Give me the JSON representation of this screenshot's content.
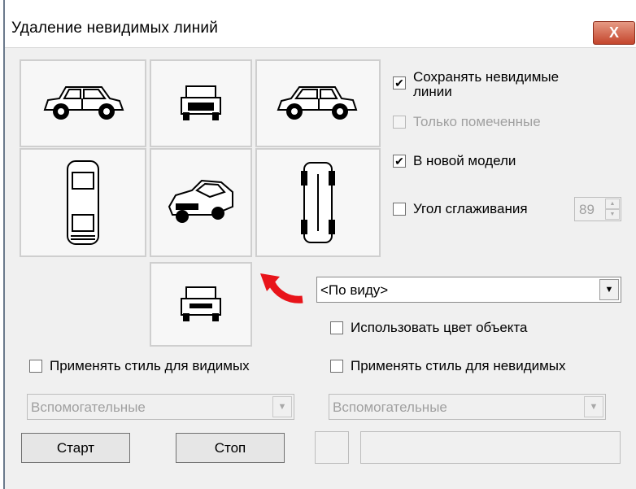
{
  "window": {
    "title": "Удаление невидимых линий",
    "close_label": "X"
  },
  "views": [
    {
      "name": "left"
    },
    {
      "name": "front"
    },
    {
      "name": "right"
    },
    {
      "name": "top"
    },
    {
      "name": "iso"
    },
    {
      "name": "bottom"
    },
    {
      "name": "rear"
    }
  ],
  "options": {
    "save_hidden": {
      "label": "Сохранять невидимые\nлинии",
      "checked": true
    },
    "only_marked": {
      "label": "Только помеченные",
      "checked": false,
      "disabled": true
    },
    "new_model": {
      "label": "В новой модели",
      "checked": true
    },
    "smoothing_angle": {
      "label": "Угол сглаживания",
      "checked": false,
      "value": "89"
    }
  },
  "view_select": {
    "value": "<По виду>"
  },
  "use_object_color": {
    "label": "Использовать цвет объекта",
    "checked": false
  },
  "visible_style": {
    "label": "Применять стиль для видимых",
    "checked": false,
    "combo_value": "Вспомогательные"
  },
  "hidden_style": {
    "label": "Применять стиль для невидимых",
    "checked": false,
    "combo_value": "Вспомогательные"
  },
  "buttons": {
    "start": "Старт",
    "stop": "Стоп"
  },
  "colors": {
    "accent_arrow": "#e8141a",
    "close_button": "#c4452c"
  }
}
